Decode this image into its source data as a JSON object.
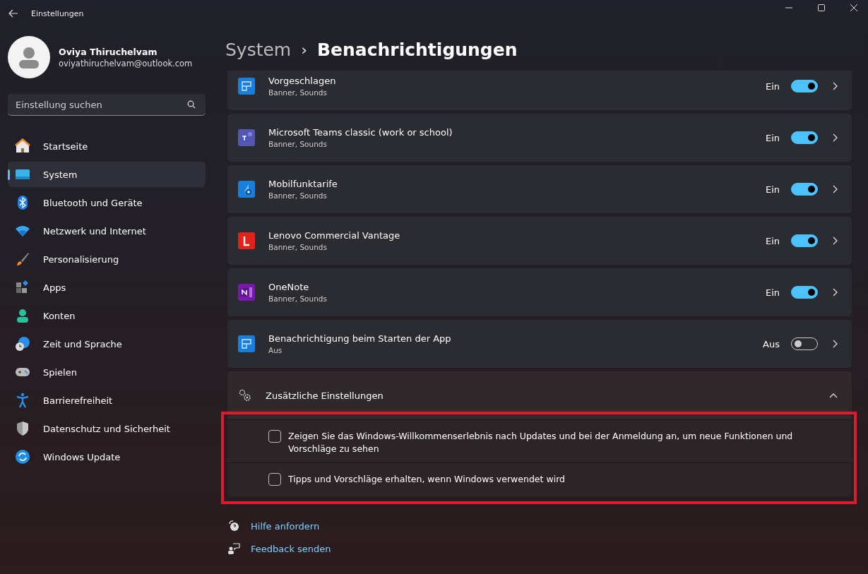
{
  "window": {
    "title": "Einstellungen"
  },
  "account": {
    "name": "Oviya Thiruchelvam",
    "email": "oviyathiruchelvam@outlook.com"
  },
  "search": {
    "placeholder": "Einstellung suchen"
  },
  "sidebar": {
    "items": [
      {
        "label": "Startseite",
        "selected": false
      },
      {
        "label": "System",
        "selected": true
      },
      {
        "label": "Bluetooth und Geräte",
        "selected": false
      },
      {
        "label": "Netzwerk und Internet",
        "selected": false
      },
      {
        "label": "Personalisierung",
        "selected": false
      },
      {
        "label": "Apps",
        "selected": false
      },
      {
        "label": "Konten",
        "selected": false
      },
      {
        "label": "Zeit und Sprache",
        "selected": false
      },
      {
        "label": "Spielen",
        "selected": false
      },
      {
        "label": "Barrierefreiheit",
        "selected": false
      },
      {
        "label": "Datenschutz und Sicherheit",
        "selected": false
      },
      {
        "label": "Windows Update",
        "selected": false
      }
    ]
  },
  "breadcrumb": {
    "parent": "System",
    "separator": "›",
    "current": "Benachrichtigungen"
  },
  "apps": [
    {
      "name": "Vorgeschlagen",
      "detail": "Banner, Sounds",
      "state": "Ein",
      "on": true
    },
    {
      "name": "Microsoft Teams classic (work or school)",
      "detail": "Banner, Sounds",
      "state": "Ein",
      "on": true
    },
    {
      "name": "Mobilfunktarife",
      "detail": "Banner, Sounds",
      "state": "Ein",
      "on": true
    },
    {
      "name": "Lenovo Commercial Vantage",
      "detail": "Banner, Sounds",
      "state": "Ein",
      "on": true
    },
    {
      "name": "OneNote",
      "detail": "Banner, Sounds",
      "state": "Ein",
      "on": true
    },
    {
      "name": "Benachrichtigung beim Starten der App",
      "detail": "Aus",
      "state": "Aus",
      "on": false
    }
  ],
  "additional_settings": {
    "title": "Zusätzliche Einstellungen",
    "expanded": true,
    "highlighted": true,
    "options": [
      {
        "label": "Zeigen Sie das Windows-Willkommenserlebnis nach Updates und bei der Anmeldung an, um neue Funktionen und Vorschläge zu sehen",
        "checked": false
      },
      {
        "label": "Tipps und Vorschläge erhalten, wenn Windows verwendet wird",
        "checked": false
      }
    ]
  },
  "links": [
    {
      "label": "Hilfe anfordern"
    },
    {
      "label": "Feedback senden"
    }
  ]
}
